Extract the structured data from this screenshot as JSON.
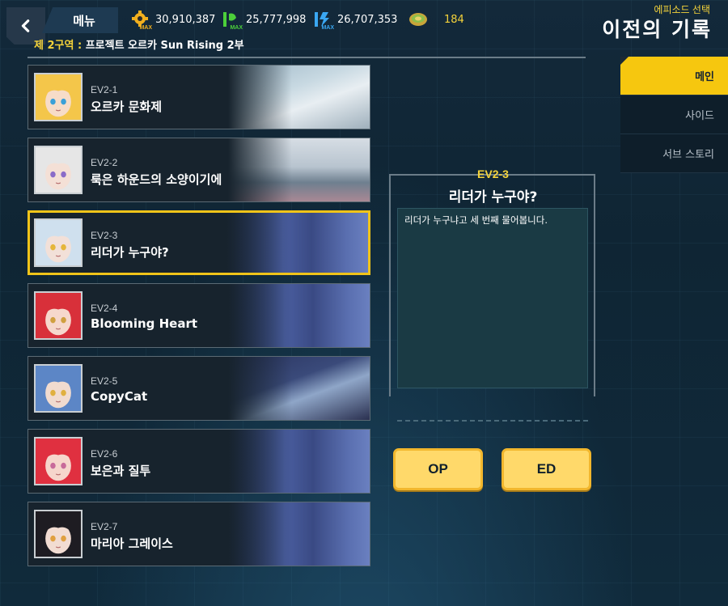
{
  "header": {
    "menu_label": "메뉴",
    "subtitle": "에피소드 선택",
    "title": "이전의 기록",
    "zone_prefix": "제 2구역 :",
    "zone_name": "프로젝트 오르카 Sun Rising 2부"
  },
  "currencies": [
    {
      "icon": "parts-icon",
      "max_label": "MAX",
      "value": "30,910,387",
      "color": "#f2b01e"
    },
    {
      "icon": "nutrient-icon",
      "max_label": "MAX",
      "value": "25,777,998",
      "color": "#4ccf3a"
    },
    {
      "icon": "power-icon",
      "max_label": "MAX",
      "value": "26,707,353",
      "color": "#3aa7f2"
    },
    {
      "icon": "tuna-can-icon",
      "value": "184",
      "color": "#f5d33a"
    }
  ],
  "episodes": [
    {
      "code": "EV2-1",
      "name": "오르카 문화제",
      "hair": "#f4c64a",
      "skin": "#f7dcc8",
      "eye": "#3aa0d8",
      "scene": "room-bright"
    },
    {
      "code": "EV2-2",
      "name": "룩은 하운드의 소양이기에",
      "hair": "#e6e6e6",
      "skin": "#f4e0d6",
      "eye": "#8a6cc8",
      "scene": "dorm"
    },
    {
      "code": "EV2-3",
      "name": "리더가 누구야?",
      "hair": "#cfe0ee",
      "skin": "#f2e0d8",
      "eye": "#e5b63a",
      "scene": "corridor"
    },
    {
      "code": "EV2-4",
      "name": "Blooming Heart",
      "hair": "#d8303a",
      "skin": "#f6d8cc",
      "eye": "#d0a040",
      "scene": "corridor"
    },
    {
      "code": "EV2-5",
      "name": "CopyCat",
      "hair": "#5c86c6",
      "skin": "#f1dbcf",
      "eye": "#e0b040",
      "scene": "night-room"
    },
    {
      "code": "EV2-6",
      "name": "보은과 질투",
      "hair": "#e03040",
      "skin": "#f6d6cc",
      "eye": "#c86a9a",
      "scene": "corridor"
    },
    {
      "code": "EV2-7",
      "name": "마리아 그레이스",
      "hair": "#1e1c22",
      "skin": "#f2dcd2",
      "eye": "#e0a040",
      "scene": "corridor"
    }
  ],
  "selected_index": 2,
  "detail": {
    "code": "EV2-3",
    "name": "리더가 누구야?",
    "description": "리더가 누구냐고 세 번째 물어봅니다."
  },
  "buttons": {
    "op": "OP",
    "ed": "ED"
  },
  "tabs": [
    {
      "label": "메인",
      "active": true
    },
    {
      "label": "사이드",
      "active": false
    },
    {
      "label": "서브 스토리",
      "active": false
    }
  ]
}
